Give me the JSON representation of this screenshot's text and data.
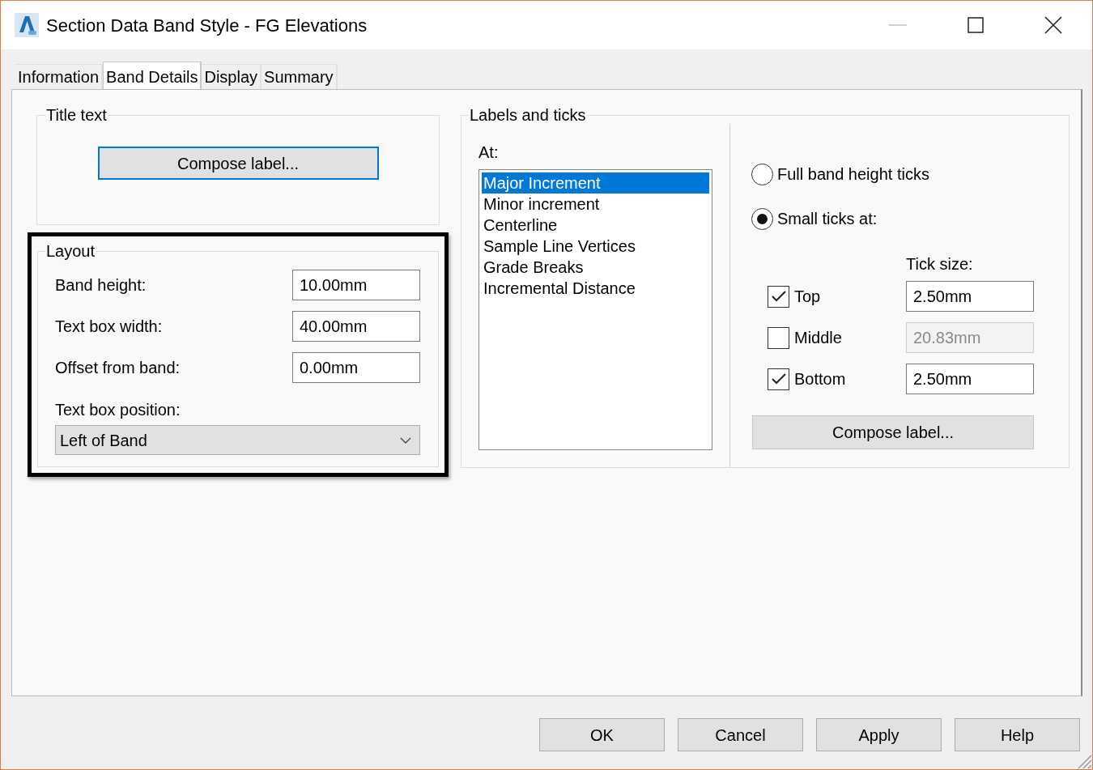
{
  "window": {
    "title": "Section Data Band Style - FG Elevations"
  },
  "tabs": [
    {
      "label": "Information",
      "selected": false
    },
    {
      "label": "Band Details",
      "selected": true
    },
    {
      "label": "Display",
      "selected": false
    },
    {
      "label": "Summary",
      "selected": false
    }
  ],
  "title_text": {
    "legend": "Title text",
    "button": "Compose label..."
  },
  "layout": {
    "legend": "Layout",
    "highlighted": true,
    "fields": [
      {
        "label": "Band height:",
        "value": "10.00mm"
      },
      {
        "label": "Text box width:",
        "value": "40.00mm"
      },
      {
        "label": "Offset from band:",
        "value": "0.00mm"
      }
    ],
    "position": {
      "label": "Text box position:",
      "value": "Left of Band"
    }
  },
  "labels_and_ticks": {
    "legend": "Labels and ticks",
    "at_label": "At:",
    "list": [
      {
        "label": "Major Increment",
        "selected": true
      },
      {
        "label": "Minor increment",
        "selected": false
      },
      {
        "label": "Centerline",
        "selected": false
      },
      {
        "label": "Sample Line Vertices",
        "selected": false
      },
      {
        "label": "Grade Breaks",
        "selected": false
      },
      {
        "label": "Incremental Distance",
        "selected": false
      }
    ],
    "tick_modes": [
      {
        "label": "Full band height ticks",
        "selected": false
      },
      {
        "label": "Small ticks at:",
        "selected": true
      }
    ],
    "tick_size_label": "Tick size:",
    "ticks": [
      {
        "label": "Top",
        "checked": true,
        "value": "2.50mm",
        "disabled": false
      },
      {
        "label": "Middle",
        "checked": false,
        "value": "20.83mm",
        "disabled": true
      },
      {
        "label": "Bottom",
        "checked": true,
        "value": "2.50mm",
        "disabled": false
      }
    ],
    "button": "Compose label..."
  },
  "buttons": [
    "OK",
    "Cancel",
    "Apply",
    "Help"
  ]
}
